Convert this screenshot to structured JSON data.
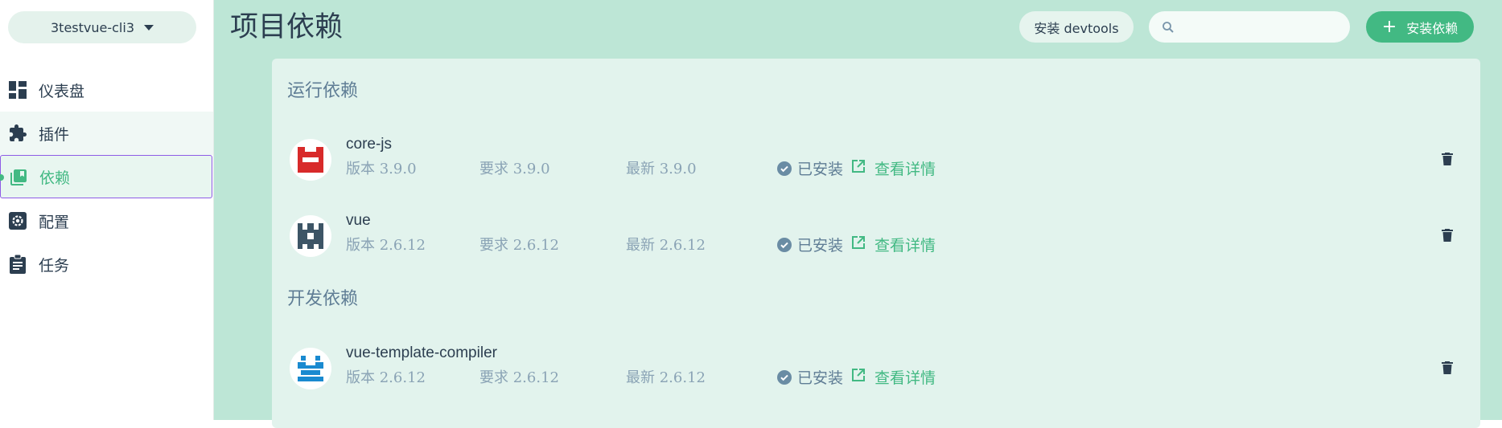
{
  "sidebar": {
    "project": "3testvue-cli3",
    "items": [
      {
        "label": "仪表盘",
        "icon": "dashboard-icon"
      },
      {
        "label": "插件",
        "icon": "puzzle-icon"
      },
      {
        "label": "依赖",
        "icon": "library-books-icon"
      },
      {
        "label": "配置",
        "icon": "settings-icon"
      },
      {
        "label": "任务",
        "icon": "clipboard-icon"
      }
    ],
    "active_index": 2
  },
  "header": {
    "title": "项目依赖",
    "devtools_label": "安装 devtools",
    "search_placeholder": "",
    "install_label": "安装依赖"
  },
  "sections": [
    {
      "title": "运行依赖",
      "deps": [
        {
          "name": "core-js",
          "version_label": "版本",
          "version": "3.9.0",
          "required_label": "要求",
          "required": "3.9.0",
          "latest_label": "最新",
          "latest": "3.9.0",
          "status": "已安装",
          "details": "查看详情",
          "logo": "core-js-logo"
        },
        {
          "name": "vue",
          "version_label": "版本",
          "version": "2.6.12",
          "required_label": "要求",
          "required": "2.6.12",
          "latest_label": "最新",
          "latest": "2.6.12",
          "status": "已安装",
          "details": "查看详情",
          "logo": "vue-logo"
        }
      ]
    },
    {
      "title": "开发依赖",
      "deps": [
        {
          "name": "vue-template-compiler",
          "version_label": "版本",
          "version": "2.6.12",
          "required_label": "要求",
          "required": "2.6.12",
          "latest_label": "最新",
          "latest": "2.6.12",
          "status": "已安装",
          "details": "查看详情",
          "logo": "vue-template-compiler-logo"
        }
      ]
    }
  ],
  "colors": {
    "accent": "#42b983",
    "main_bg": "#bde6d6",
    "panel_bg": "#e2f3ed",
    "core_js_logo": "#d82a2a",
    "vue_logo": "#3d5566",
    "vtc_logo": "#1a8ad0"
  }
}
